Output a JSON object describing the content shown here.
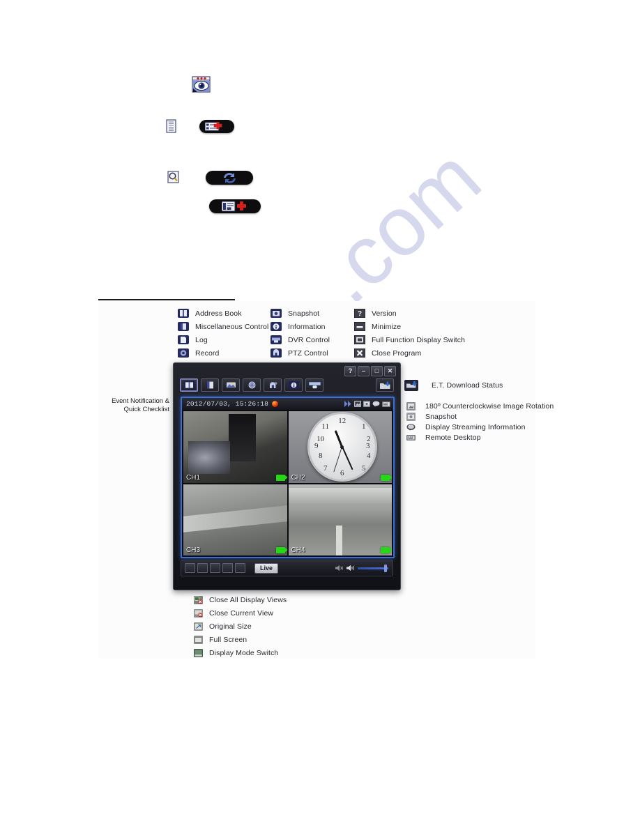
{
  "watermark": {
    "text_1": ".com",
    "text_2": "m"
  },
  "illustrations": [
    {
      "name": "live-view-eye-icon",
      "label": ""
    },
    {
      "name": "notepad-icon",
      "label": ""
    },
    {
      "name": "add-address-book-entry-button",
      "label": ""
    },
    {
      "name": "search-magnifier-icon",
      "label": ""
    },
    {
      "name": "refresh-sync-button",
      "label": ""
    },
    {
      "name": "add-device-button",
      "label": ""
    }
  ],
  "legend": {
    "column_1": [
      {
        "icon": "address-book-icon",
        "label": "Address Book"
      },
      {
        "icon": "miscellaneous-control-icon",
        "label": "Miscellaneous Control"
      },
      {
        "icon": "log-icon",
        "label": "Log"
      },
      {
        "icon": "record-icon",
        "label": "Record"
      }
    ],
    "column_2": [
      {
        "icon": "snapshot-icon",
        "label": "Snapshot"
      },
      {
        "icon": "information-icon",
        "label": "Information"
      },
      {
        "icon": "dvr-control-icon",
        "label": "DVR Control"
      },
      {
        "icon": "ptz-control-icon",
        "label": "PTZ Control"
      }
    ],
    "column_3": [
      {
        "icon": "version-icon",
        "label": "Version"
      },
      {
        "icon": "minimize-icon",
        "label": "Minimize"
      },
      {
        "icon": "full-function-display-switch-icon",
        "label": "Full Function Display Switch"
      },
      {
        "icon": "close-program-icon",
        "label": "Close Program"
      }
    ],
    "column_right_top": [
      {
        "icon": "et-download-status-icon",
        "label": "E.T. Download Status"
      }
    ],
    "column_right": [
      {
        "icon": "image-rotation-icon",
        "label": "180º Counterclockwise Image Rotation"
      },
      {
        "icon": "snapshot-icon",
        "label": "Snapshot"
      },
      {
        "icon": "display-streaming-information-icon",
        "label": "Display Streaming Information"
      },
      {
        "icon": "remote-desktop-icon",
        "label": "Remote Desktop"
      }
    ],
    "column_bottom": [
      {
        "icon": "close-all-display-views-icon",
        "label": "Close All Display Views"
      },
      {
        "icon": "close-current-view-icon",
        "label": "Close Current View"
      },
      {
        "icon": "original-size-icon",
        "label": "Original Size"
      },
      {
        "icon": "full-screen-icon",
        "label": "Full Screen"
      },
      {
        "icon": "display-mode-switch-icon",
        "label": "Display Mode Switch"
      }
    ]
  },
  "event_notification": {
    "line_1": "Event Notification &",
    "line_2": "Quick Checklist"
  },
  "app_window": {
    "title_buttons": [
      {
        "name": "help-button",
        "glyph": "?"
      },
      {
        "name": "minimize-button",
        "glyph": "–"
      },
      {
        "name": "restore-button",
        "glyph": "□"
      },
      {
        "name": "close-button",
        "glyph": "✕"
      }
    ],
    "toolbar": [
      {
        "name": "address-book-button",
        "selected": true
      },
      {
        "name": "log-button",
        "selected": false
      },
      {
        "name": "snapshot-button",
        "selected": false
      },
      {
        "name": "record-button",
        "selected": false
      },
      {
        "name": "ptz-control-button",
        "selected": false
      },
      {
        "name": "information-button",
        "selected": false
      },
      {
        "name": "dvr-control-button",
        "selected": false
      }
    ],
    "folder_button": {
      "name": "et-download-status-button"
    },
    "viewport": {
      "timestamp": "2012/07/03, 15:26:18",
      "status_icons": [
        "expand-icon",
        "image-rotation-icon",
        "snapshot-icon",
        "display-streaming-information-icon",
        "remote-desktop-icon"
      ],
      "channels": [
        {
          "label": "CH1",
          "recording": true
        },
        {
          "label": "CH2",
          "recording": true
        },
        {
          "label": "CH3",
          "recording": true
        },
        {
          "label": "CH4",
          "recording": true
        }
      ]
    },
    "bottom_bar": {
      "buttons": [
        "close-all-display-views-button",
        "close-current-view-button",
        "original-size-button",
        "full-screen-button",
        "display-mode-switch-button"
      ],
      "mode_label": "Live",
      "volume_percent": 90
    }
  },
  "clock": {
    "numerals": [
      "12",
      "1",
      "2",
      "3",
      "4",
      "5",
      "6",
      "7",
      "8",
      "9",
      "10",
      "11"
    ]
  },
  "colors": {
    "accent_blue": "#3b6fd4",
    "legend_icon_navy": "#242a5e",
    "legend_icon_gray": "#6f7276",
    "recording_green": "#27d616",
    "alert_red": "#d4200a",
    "watermark": "#c9cbe8"
  }
}
